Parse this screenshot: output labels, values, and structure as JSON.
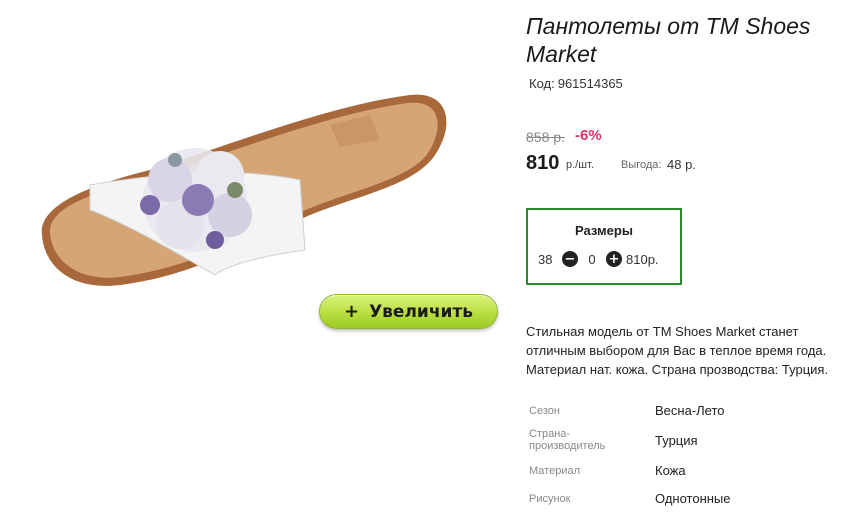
{
  "product": {
    "title": "Пантолеты от TM Shoes Market",
    "code_label": "Код:",
    "code_value": "961514365",
    "image_icon": "sandal-product-image"
  },
  "zoom": {
    "label": "Увеличить",
    "icon": "+"
  },
  "price": {
    "old": "858 р.",
    "discount": "-6%",
    "current": "810",
    "unit": "р./шт.",
    "profit_label": "Выгода:",
    "profit_value": "48 р."
  },
  "sizes": {
    "title": "Размеры",
    "row": {
      "size": "38",
      "minus": "−",
      "quantity": "0",
      "plus": "+",
      "price": "810р."
    }
  },
  "description": {
    "lines": [
      "Стильная модель от TM Shoes Market станет",
      "отличным выбором для Вас в теплое время года.",
      "Материал нат. кожа. Страна прозводства: Турция."
    ]
  },
  "attributes": [
    {
      "label": "Сезон",
      "value": "Весна-Лето"
    },
    {
      "label_line1": "Страна-",
      "label_line2": "производитель",
      "value": "Турция"
    },
    {
      "label": "Материал",
      "value": "Кожа"
    },
    {
      "label": "Рисунок",
      "value": "Однотонные"
    }
  ],
  "colors": {
    "accent_green": "#2c8a2c",
    "discount_pink": "#e0336d",
    "button_green": "#bfe24a"
  }
}
